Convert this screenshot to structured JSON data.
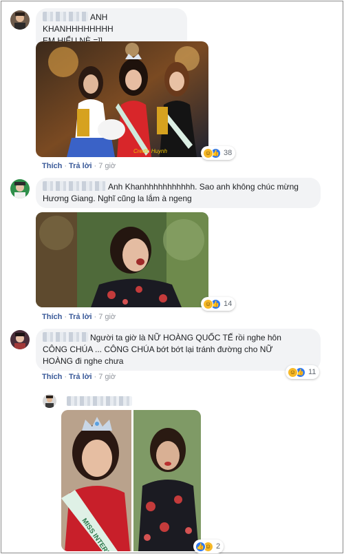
{
  "comments": [
    {
      "text_lines": [
        "ANH KHANHHHHHHHH",
        "EM HIỂU NÈ =]]"
      ],
      "reactions": {
        "icons": [
          "haha-icon",
          "like-icon"
        ],
        "count": "38"
      },
      "actions": {
        "like": "Thích",
        "reply": "Trả lời",
        "time": "7 giờ"
      },
      "photo_watermark": "Credit: Huynh"
    },
    {
      "text_lines": [
        "Anh Khanhhhhhhhhhhh. Sao anh không chúc mừng",
        "Hương Giang. Nghĩ cũng la lắm à ngeng"
      ],
      "reactions": {
        "icons": [
          "haha-icon",
          "like-icon"
        ],
        "count": "14"
      },
      "actions": {
        "like": "Thích",
        "reply": "Trả lời",
        "time": "7 giờ"
      }
    },
    {
      "text_lines": [
        "Người ta giờ là NỮ HOÀNG QUỐC TẾ rồi nghe hôn",
        "CÔNG CHÚA ... CÔNG CHÚA bớt bớt lại tránh đường cho NỮ",
        "HOÀNG đi nghe chưa"
      ],
      "reactions": {
        "icons": [
          "haha-icon",
          "like-icon"
        ],
        "count": "11"
      },
      "actions": {
        "like": "Thích",
        "reply": "Trả lời",
        "time": "7 giờ"
      }
    }
  ],
  "reply": {
    "reactions": {
      "icons": [
        "like-icon",
        "haha-icon"
      ],
      "count": "2"
    },
    "sash_text": "MISS INTERN"
  },
  "colors": {
    "bubble": "#f2f3f5",
    "link": "#385898",
    "meta": "#90949c",
    "like": "#2e78f0",
    "haha": "#f7b928"
  }
}
